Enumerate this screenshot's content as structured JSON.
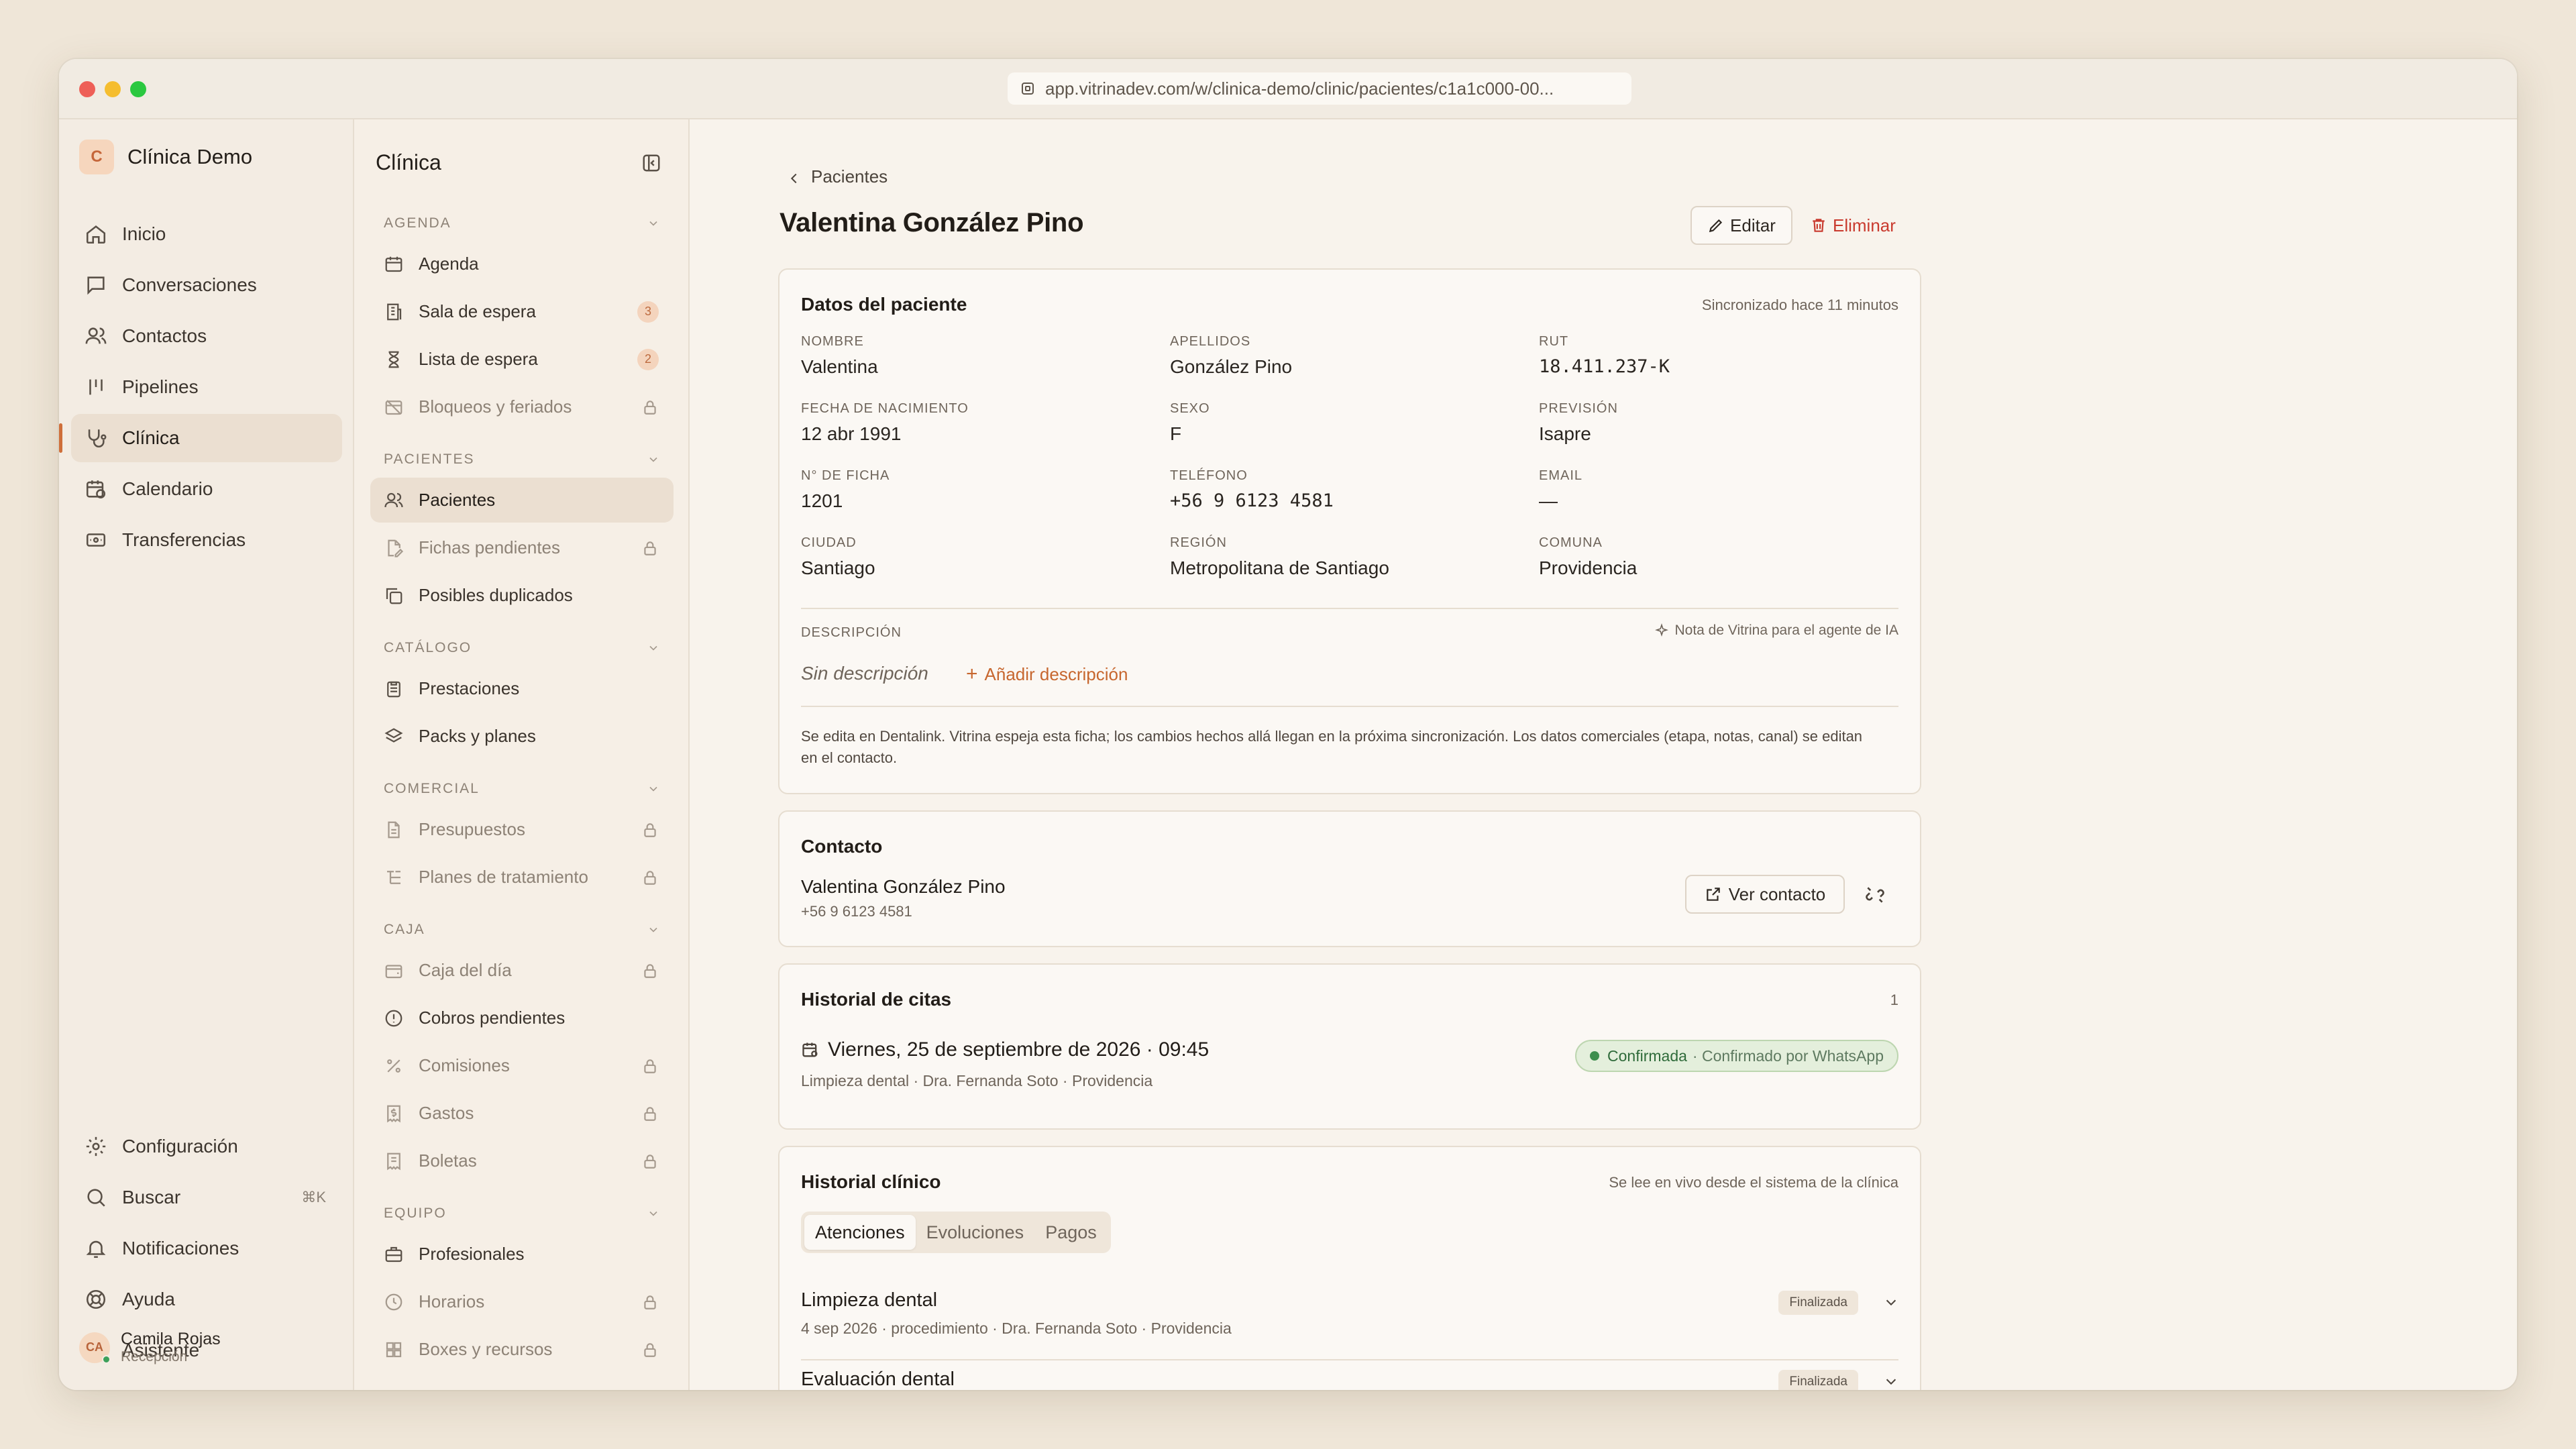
{
  "browser": {
    "url": "app.vitrinadev.com/w/clinica-demo/clinic/pacientes/c1a1c000-00..."
  },
  "workspace": {
    "initial": "C",
    "name": "Clínica Demo"
  },
  "nav_primary": [
    {
      "label": "Inicio",
      "icon": "home-icon"
    },
    {
      "label": "Conversaciones",
      "icon": "chat-icon"
    },
    {
      "label": "Contactos",
      "icon": "users-icon"
    },
    {
      "label": "Pipelines",
      "icon": "pipeline-icon"
    },
    {
      "label": "Clínica",
      "icon": "stethoscope-icon",
      "active": true
    },
    {
      "label": "Calendario",
      "icon": "calendar-clock-icon"
    },
    {
      "label": "Transferencias",
      "icon": "transfer-icon"
    }
  ],
  "nav_bottom": {
    "settings": "Configuración",
    "search": "Buscar",
    "search_shortcut": "⌘K",
    "notifications": "Notificaciones",
    "help": "Ayuda",
    "assistant": "Asistente"
  },
  "user": {
    "initials": "CA",
    "name": "Camila Rojas",
    "role": "Recepción"
  },
  "clinic_nav": {
    "title": "Clínica",
    "sections": [
      {
        "label": "AGENDA",
        "items": [
          {
            "label": "Agenda",
            "icon": "calendar-icon"
          },
          {
            "label": "Sala de espera",
            "icon": "building-icon",
            "badge": "3"
          },
          {
            "label": "Lista de espera",
            "icon": "hourglass-icon",
            "badge": "2"
          },
          {
            "label": "Bloqueos y feriados",
            "icon": "calendar-off-icon",
            "locked": true
          }
        ]
      },
      {
        "label": "PACIENTES",
        "items": [
          {
            "label": "Pacientes",
            "icon": "users-icon",
            "active": true
          },
          {
            "label": "Fichas pendientes",
            "icon": "file-edit-icon",
            "locked": true
          },
          {
            "label": "Posibles duplicados",
            "icon": "copy-icon"
          }
        ]
      },
      {
        "label": "CATÁLOGO",
        "items": [
          {
            "label": "Prestaciones",
            "icon": "clipboard-icon"
          },
          {
            "label": "Packs y planes",
            "icon": "layers-icon"
          }
        ]
      },
      {
        "label": "COMERCIAL",
        "items": [
          {
            "label": "Presupuestos",
            "icon": "document-icon",
            "locked": true
          },
          {
            "label": "Planes de tratamiento",
            "icon": "list-tree-icon",
            "locked": true
          }
        ]
      },
      {
        "label": "CAJA",
        "items": [
          {
            "label": "Caja del día",
            "icon": "wallet-icon",
            "locked": true
          },
          {
            "label": "Cobros pendientes",
            "icon": "alert-circle-icon"
          },
          {
            "label": "Comisiones",
            "icon": "percent-icon",
            "locked": true
          },
          {
            "label": "Gastos",
            "icon": "receipt-dollar-icon",
            "locked": true
          },
          {
            "label": "Boletas",
            "icon": "receipt-icon",
            "locked": true
          }
        ]
      },
      {
        "label": "EQUIPO",
        "items": [
          {
            "label": "Profesionales",
            "icon": "briefcase-icon"
          },
          {
            "label": "Horarios",
            "icon": "clock-icon",
            "locked": true
          },
          {
            "label": "Boxes y recursos",
            "icon": "grid-icon",
            "locked": true
          }
        ]
      }
    ]
  },
  "page": {
    "breadcrumb": "Pacientes",
    "title": "Valentina González Pino",
    "edit_label": "Editar",
    "delete_label": "Eliminar"
  },
  "patient_card": {
    "title": "Datos del paciente",
    "sync_status": "Sincronizado hace 11 minutos",
    "fields": [
      {
        "label": "NOMBRE",
        "value": "Valentina"
      },
      {
        "label": "APELLIDOS",
        "value": "González Pino"
      },
      {
        "label": "RUT",
        "value": "18.411.237-K",
        "mono": true
      },
      {
        "label": "FECHA DE NACIMIENTO",
        "value": "12 abr 1991"
      },
      {
        "label": "SEXO",
        "value": "F"
      },
      {
        "label": "PREVISIÓN",
        "value": "Isapre"
      },
      {
        "label": "N° DE FICHA",
        "value": "1201"
      },
      {
        "label": "TELÉFONO",
        "value": "+56 9 6123 4581",
        "mono": true
      },
      {
        "label": "EMAIL",
        "value": "—"
      },
      {
        "label": "CIUDAD",
        "value": "Santiago"
      },
      {
        "label": "REGIÓN",
        "value": "Metropolitana de Santiago"
      },
      {
        "label": "COMUNA",
        "value": "Providencia"
      }
    ],
    "description_label": "DESCRIPCIÓN",
    "ai_note": "Nota de Vitrina para el agente de IA",
    "no_description": "Sin descripción",
    "add_description": "Añadir descripción",
    "footnote": "Se edita en Dentalink. Vitrina espeja esta ficha; los cambios hechos allá llegan en la próxima sincronización. Los datos comerciales (etapa, notas, canal) se editan en el contacto."
  },
  "contact_card": {
    "title": "Contacto",
    "name": "Valentina González Pino",
    "phone": "+56 9 6123 4581",
    "view_label": "Ver contacto"
  },
  "appointments_card": {
    "title": "Historial de citas",
    "count": "1",
    "items": [
      {
        "date": "Viernes, 25 de septiembre de 2026 · 09:45",
        "detail": "Limpieza dental · Dra. Fernanda Soto · Providencia",
        "status": "Confirmada",
        "status_detail": "· Confirmado por WhatsApp"
      }
    ]
  },
  "clinical_card": {
    "title": "Historial clínico",
    "source_note": "Se lee en vivo desde el sistema de la clínica",
    "tabs": [
      "Atenciones",
      "Evoluciones",
      "Pagos"
    ],
    "active_tab": "Atenciones",
    "items": [
      {
        "name": "Limpieza dental",
        "detail": "4 sep 2026 · procedimiento · Dra. Fernanda Soto · Providencia",
        "status": "Finalizada"
      },
      {
        "name": "Evaluación dental",
        "detail": "",
        "status": "Finalizada"
      }
    ]
  },
  "colors": {
    "accent": "#cf6f3a",
    "danger": "#c93a2e",
    "success": "#3e8e4e",
    "background": "#f8f3ec"
  }
}
